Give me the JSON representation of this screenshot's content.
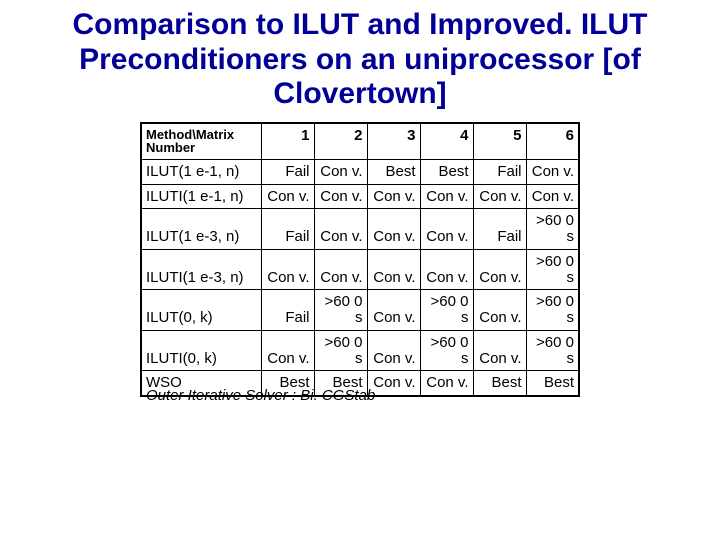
{
  "title": "Comparison to ILUT and Improved. ILUT Preconditioners on an uniprocessor [of Clovertown]",
  "header": {
    "rowhead": "Method\\Matrix Number",
    "cols": [
      "1",
      "2",
      "3",
      "4",
      "5",
      "6"
    ]
  },
  "rows": [
    {
      "label": "ILUT(1 e-1, n)",
      "cells": [
        "Fail",
        "Con v.",
        "Best",
        "Best",
        "Fail",
        "Con v."
      ]
    },
    {
      "label": "ILUTI(1 e-1, n)",
      "cells": [
        "Con v.",
        "Con v.",
        "Con v.",
        "Con v.",
        "Con v.",
        "Con v."
      ]
    },
    {
      "label": "ILUT(1 e-3, n)",
      "cells": [
        "Fail",
        "Con v.",
        "Con v.",
        "Con v.",
        "Fail",
        ">60 0 s"
      ]
    },
    {
      "label": "ILUTI(1 e-3, n)",
      "cells": [
        "Con v.",
        "Con v.",
        "Con v.",
        "Con v.",
        "Con v.",
        ">60 0 s"
      ]
    },
    {
      "label": "ILUT(0, k)",
      "cells": [
        "Fail",
        ">60 0 s",
        "Con v.",
        ">60 0 s",
        "Con v.",
        ">60 0 s"
      ]
    },
    {
      "label": "ILUTI(0, k)",
      "cells": [
        "Con v.",
        ">60 0 s",
        "Con v.",
        ">60 0 s",
        "Con v.",
        ">60 0 s"
      ]
    },
    {
      "label": "WSO",
      "cells": [
        "Best",
        "Best",
        "Con v.",
        "Con v.",
        "Best",
        "Best"
      ]
    }
  ],
  "footnote": "Outer Iterative Solver : Bi. CGStab"
}
